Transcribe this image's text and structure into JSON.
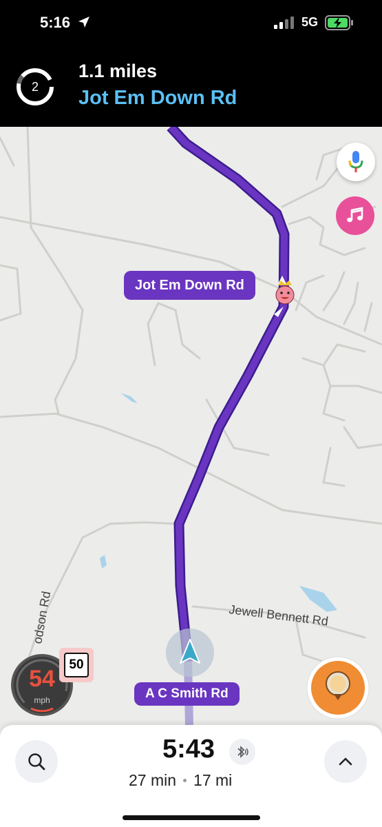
{
  "status_bar": {
    "time": "5:16",
    "network": "5G"
  },
  "navigation": {
    "exit_number": "2",
    "distance": "1.1 miles",
    "next_street": "Jot Em Down Rd"
  },
  "map": {
    "turn_label": "Jot Em Down Rd",
    "current_road": "A C Smith Rd",
    "road_labels": {
      "jewell": "Jewell Bennett Rd",
      "dodson": "odson Rd"
    },
    "route_color": "#6a35c0"
  },
  "speed": {
    "current": "54",
    "unit": "mph",
    "limit": "50"
  },
  "trip": {
    "eta": "5:43",
    "duration": "27 min",
    "distance": "17 mi"
  },
  "icons": {
    "location": "location-arrow-icon",
    "mic": "google-mic-icon",
    "music": "music-note-icon",
    "search": "search-icon",
    "expand": "chevron-up-icon",
    "bluetooth": "bluetooth-audio-icon",
    "report": "report-pin-icon"
  }
}
